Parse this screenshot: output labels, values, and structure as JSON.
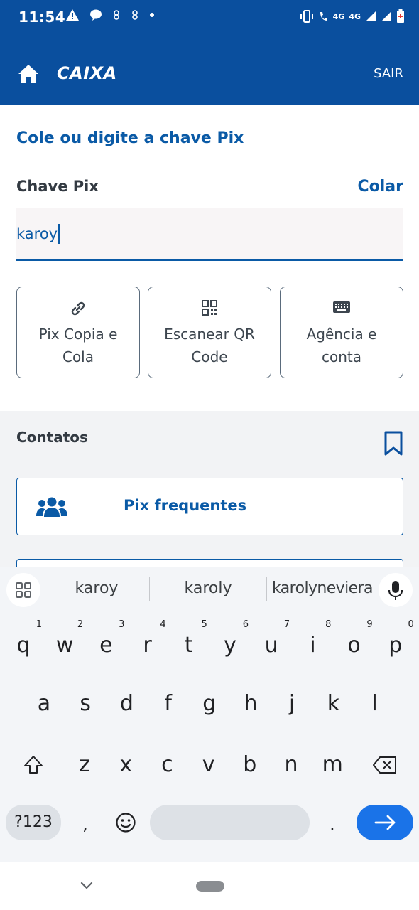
{
  "status_bar": {
    "time": "11:54",
    "network_1": "4G",
    "network_2": "4G"
  },
  "header": {
    "brand": "CAIXA",
    "logout_label": "SAIR"
  },
  "form": {
    "title": "Cole ou digite a chave Pix",
    "key_label": "Chave Pix",
    "paste_label": "Colar",
    "key_input_value": "karoy",
    "options": [
      {
        "line1": "Pix Copia e",
        "line2": "Cola",
        "icon": "link-icon"
      },
      {
        "line1": "Escanear QR",
        "line2": "Code",
        "icon": "qr-code-icon"
      },
      {
        "line1": "Agência e",
        "line2": "conta",
        "icon": "keyboard-icon"
      }
    ]
  },
  "contacts": {
    "title": "Contatos",
    "frequent_label": "Pix frequentes"
  },
  "keyboard": {
    "suggestions": [
      "karoy",
      "karoly",
      "karolyneviera"
    ],
    "row1": [
      "q",
      "w",
      "e",
      "r",
      "t",
      "y",
      "u",
      "i",
      "o",
      "p"
    ],
    "row1_numbers": [
      "1",
      "2",
      "3",
      "4",
      "5",
      "6",
      "7",
      "8",
      "9",
      "0"
    ],
    "row2": [
      "a",
      "s",
      "d",
      "f",
      "g",
      "h",
      "j",
      "k",
      "l"
    ],
    "row3": [
      "z",
      "x",
      "c",
      "v",
      "b",
      "n",
      "m"
    ],
    "symbols_label": "?123",
    "comma_label": ",",
    "period_label": "."
  },
  "colors": {
    "brand_blue": "#0a4f9e",
    "accent_blue": "#0a5aa6",
    "enter_blue": "#1a73e8"
  }
}
